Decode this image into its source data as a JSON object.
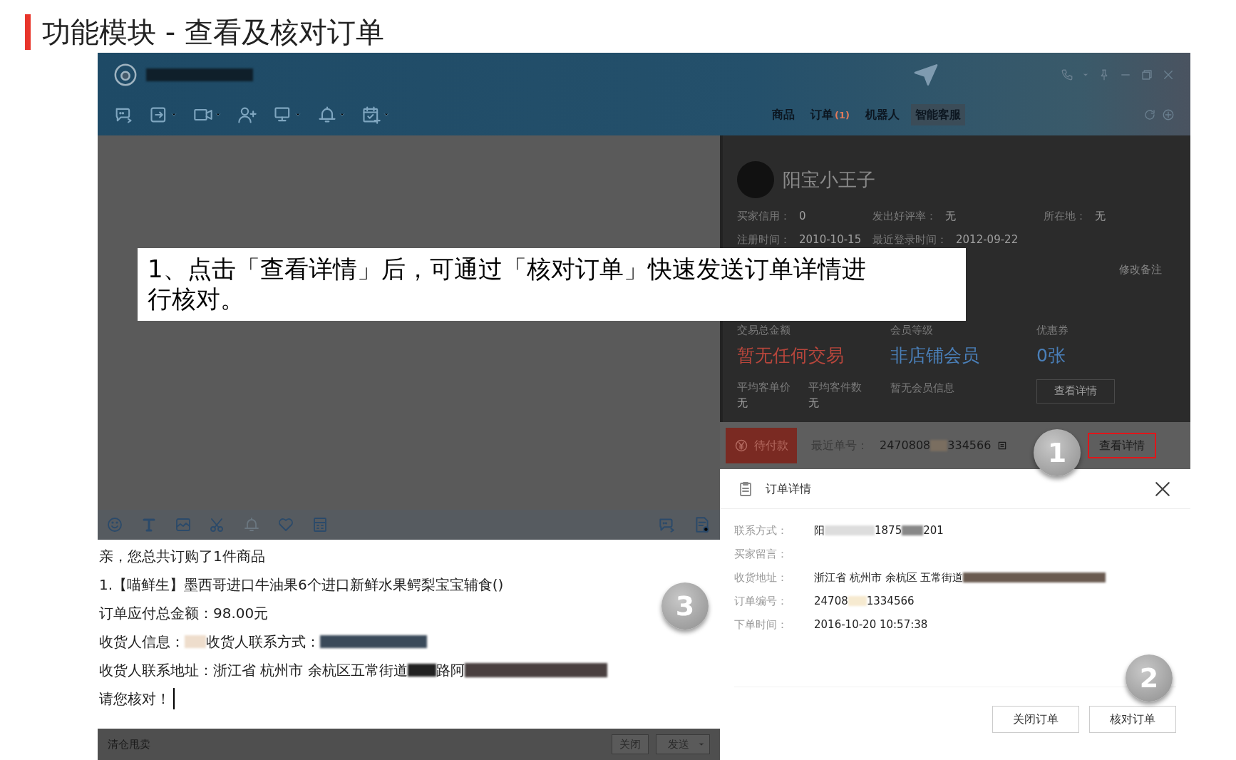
{
  "slide_title": "功能模块 - 查看及核对订单",
  "window": {
    "tabs": [
      {
        "label": "商品",
        "selected": false
      },
      {
        "label": "订单",
        "count": "(1)",
        "selected": false
      },
      {
        "label": "机器人",
        "selected": false
      },
      {
        "label": "智能客服",
        "selected": true
      }
    ]
  },
  "buyer": {
    "name": "阳宝小王子",
    "fields": [
      {
        "label": "买家信用：",
        "value": "0"
      },
      {
        "label": "发出好评率：",
        "value": "无"
      },
      {
        "label": "所在地：",
        "value": "无"
      },
      {
        "label": "注册时间：",
        "value": "2010-10-15"
      },
      {
        "label": "最近登录时间：",
        "value": "2012-09-22"
      }
    ],
    "remark_button": "修改备注"
  },
  "stats": [
    {
      "label": "交易总金额",
      "value": "暂无任何交易",
      "color": "#b8463c"
    },
    {
      "label": "会员等级",
      "value": "非店铺会员",
      "color": "#4a7fb8"
    },
    {
      "label": "优惠券",
      "value": "0张",
      "color": "#4a7fb8"
    }
  ],
  "averages": [
    {
      "label": "平均客单价",
      "value": "无"
    },
    {
      "label": "平均客件数",
      "value": "无"
    }
  ],
  "member_info": "暂无会员信息",
  "member_button": "查看详情",
  "order_bar": {
    "status": "待付款",
    "label": "最近单号：",
    "number_start": "2470808",
    "number_end": "334566",
    "details_button": "查看详情"
  },
  "dialog": {
    "title": "订单详情",
    "rows": [
      {
        "label": "联系方式：",
        "value": "阳"
      },
      {
        "label": "买家留言：",
        "value": ""
      },
      {
        "label": "收货地址：",
        "value": "浙江省 杭州市 余杭区 五常街道"
      },
      {
        "label": "订单编号：",
        "value": "24708"
      },
      {
        "label": "下单时间：",
        "value": "2016-10-20 10:57:38"
      }
    ],
    "extras": {
      "0": [
        "1875",
        "201"
      ],
      "3": [
        "1334566"
      ]
    },
    "buttons": [
      "关闭订单",
      "核对订单"
    ]
  },
  "chat": {
    "lines": [
      "亲，您总共订购了1件商品",
      "1.【喵鲜生】墨西哥进口牛油果6个进口新鲜水果鳄梨宝宝辅食()",
      "订单应付总金额：98.00元",
      "收货人信息：",
      "收货人联系方式：",
      "收货人联系地址：浙江省 杭州市 余杭区五常街道",
      "路阿",
      "请您核对！"
    ],
    "signature": "清仓甩卖",
    "buttons": [
      "关闭",
      "发送"
    ]
  },
  "callout": "1、点击「查看详情」后，可通过「核对订单」快速发送订单详情进行核对。",
  "steps": [
    "1",
    "2",
    "3"
  ]
}
